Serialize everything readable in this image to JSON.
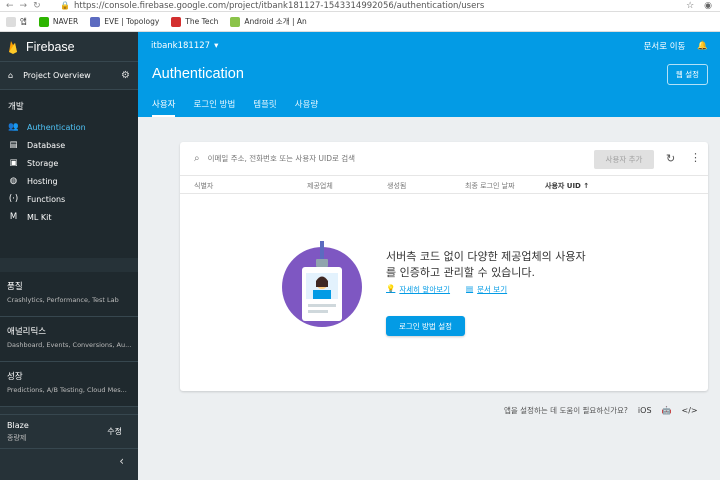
{
  "browser": {
    "url": "https://console.firebase.google.com/project/itbank181127-1543314992056/authentication/users",
    "bookmarks": [
      "앱",
      "NAVER",
      "EVE | Topology",
      "The Tech",
      "Android 소개 | An"
    ]
  },
  "sidebar": {
    "brand": "Firebase",
    "overview": "Project Overview",
    "develop_title": "개발",
    "items": [
      {
        "label": "Authentication",
        "icon": "people-icon"
      },
      {
        "label": "Database",
        "icon": "database-icon"
      },
      {
        "label": "Storage",
        "icon": "storage-icon"
      },
      {
        "label": "Hosting",
        "icon": "globe-icon"
      },
      {
        "label": "Functions",
        "icon": "functions-icon"
      },
      {
        "label": "ML Kit",
        "icon": "ml-kit-icon"
      }
    ],
    "groups": [
      {
        "title": "품질",
        "sub": "Crashlytics, Performance, Test Lab"
      },
      {
        "title": "애널리틱스",
        "sub": "Dashboard, Events, Conversions, Au..."
      },
      {
        "title": "성장",
        "sub": "Predictions, A/B Testing, Cloud Mes..."
      }
    ],
    "plan": {
      "name": "Blaze",
      "sub": "종량제",
      "edit": "수정"
    }
  },
  "header": {
    "project": "itbank181127",
    "docs": "문서로 이동",
    "title": "Authentication",
    "web_setup": "웹 설정",
    "tabs": [
      "사용자",
      "로그인 방법",
      "템플릿",
      "사용량"
    ]
  },
  "card": {
    "search_placeholder": "이메일 주소, 전화번호 또는 사용자 UID로 검색",
    "add_user": "사용자 추가",
    "columns": [
      "식별자",
      "제공업체",
      "생성됨",
      "최종 로그인 날짜",
      "사용자 UID"
    ],
    "empty_line1": "서버측 코드 없이 다양한 제공업체의 사용자",
    "empty_line2": "를 인증하고 관리할 수 있습니다.",
    "learn_more": "자세히 알아보기",
    "view_docs": "문서 보기",
    "setup_button": "로그인 방법 설정"
  },
  "footer": {
    "help": "앱을 설정하는 데 도움이 필요하신가요?",
    "ios": "iOS"
  },
  "colors": {
    "primary": "#039be5",
    "sidebar": "#263238",
    "active": "#4fc3f7"
  }
}
